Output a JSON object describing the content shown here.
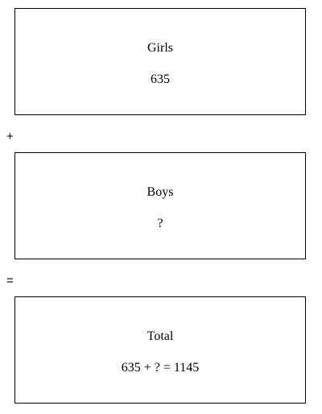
{
  "boxes": {
    "girls": {
      "label": "Girls",
      "value": "635"
    },
    "boys": {
      "label": "Boys",
      "value": "?"
    },
    "total": {
      "label": "Total",
      "value": "635 + ? = 1145"
    }
  },
  "operators": {
    "plus": "+",
    "equals": "="
  }
}
